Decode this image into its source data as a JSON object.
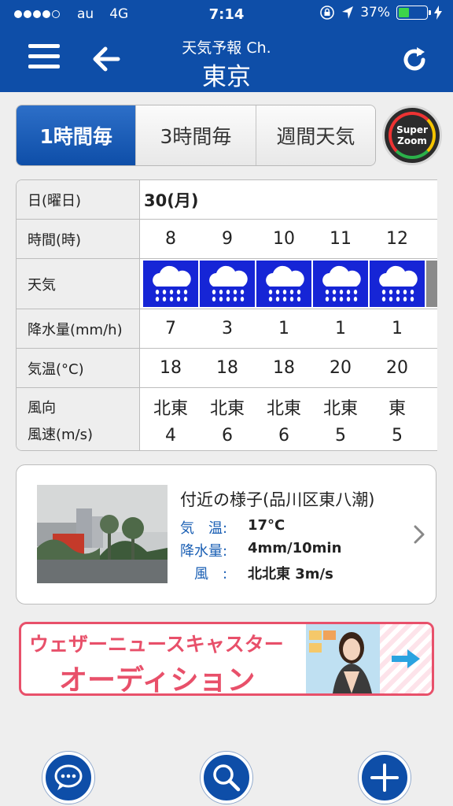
{
  "status": {
    "carrier": "au",
    "network": "4G",
    "time": "7:14",
    "battery": "37%",
    "battery_level": 0.37,
    "signal_bars": 4
  },
  "header": {
    "subtitle": "天気予報 Ch.",
    "title": "東京"
  },
  "tabs": [
    {
      "label": "1時間毎",
      "active": true
    },
    {
      "label": "3時間毎",
      "active": false
    },
    {
      "label": "週間天気",
      "active": false
    }
  ],
  "superzoom": {
    "line1": "Super",
    "line2": "Zoom"
  },
  "table": {
    "labels": {
      "date": "日(曜日)",
      "time": "時間(時)",
      "weather": "天気",
      "precip": "降水量(mm/h)",
      "temp": "気温(°C)",
      "wind_dir": "風向",
      "wind_speed": "風速(m/s)"
    },
    "date": "30(月)",
    "hours": [
      "8",
      "9",
      "10",
      "11",
      "12"
    ],
    "weather_icons": [
      "heavy-rain-icon",
      "heavy-rain-icon",
      "heavy-rain-icon",
      "heavy-rain-icon",
      "heavy-rain-icon"
    ],
    "precip": [
      "7",
      "3",
      "1",
      "1",
      "1"
    ],
    "temp": [
      "18",
      "18",
      "18",
      "20",
      "20"
    ],
    "wind_dir": [
      "北東",
      "北東",
      "北東",
      "北東",
      "東"
    ],
    "wind_speed": [
      "4",
      "6",
      "6",
      "5",
      "5"
    ]
  },
  "nearby": {
    "title": "付近の様子(品川区東八潮)",
    "temp_label": "気　温:",
    "temp_value": "17°C",
    "precip_label": "降水量:",
    "precip_value": "4mm/10min",
    "wind_label": "　風　:",
    "wind_value": "北北東 3m/s"
  },
  "banner": {
    "line1": "ウェザーニュースキャスター",
    "line2": "オーディション"
  },
  "colors": {
    "header_blue": "#0e4ea8",
    "weather_cell": "#1625d6",
    "banner_pink": "#e8506a"
  },
  "bottom_icons": [
    "chat-icon",
    "search-icon",
    "plus-icon"
  ]
}
